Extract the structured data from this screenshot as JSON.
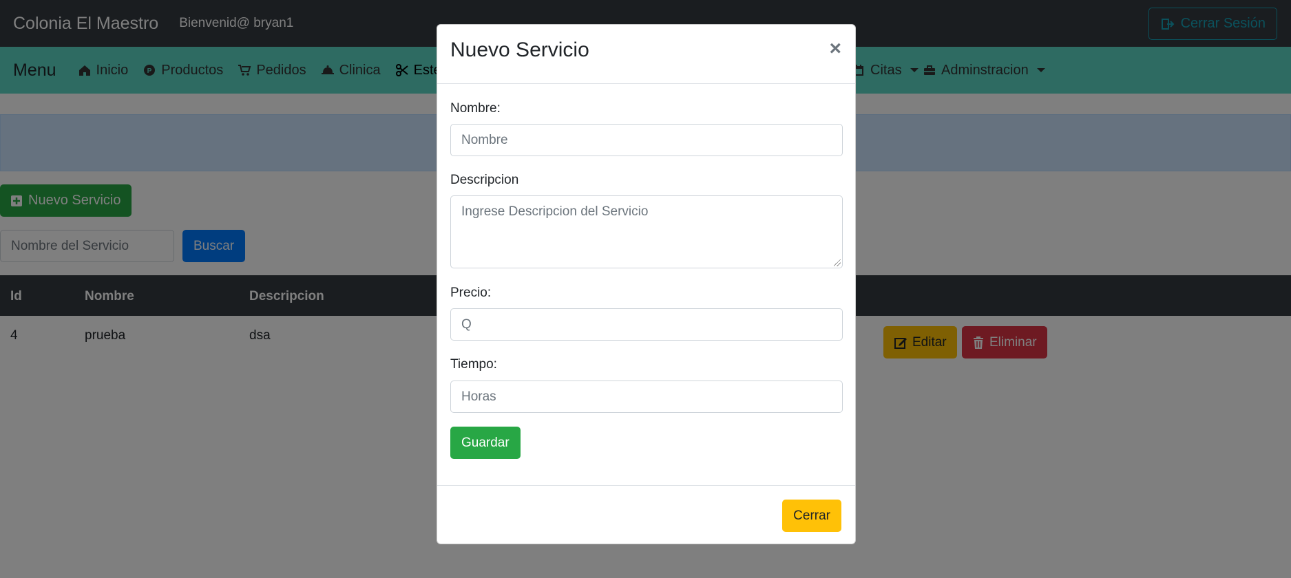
{
  "navbar": {
    "brand": "Colonia El Maestro",
    "welcome": "Bienvenid@ bryan1",
    "logout_label": "Cerrar Sesión",
    "logout_icon": "sign-out-icon"
  },
  "menu": {
    "title": "Menu",
    "items": [
      {
        "label": "Inicio",
        "icon": "home-icon"
      },
      {
        "label": "Productos",
        "icon": "product-icon"
      },
      {
        "label": "Pedidos",
        "icon": "cart-icon"
      },
      {
        "label": "Clinica",
        "icon": "bell-icon"
      },
      {
        "label": "Estetica",
        "icon": "scissors-icon"
      },
      {
        "label": "Citas",
        "icon": "calendar-icon"
      },
      {
        "label": "Adminstracion",
        "icon": "toolbox-icon"
      }
    ]
  },
  "page": {
    "new_button_label": "Nuevo Servicio",
    "search_placeholder": "Nombre del Servicio",
    "search_button_label": "Buscar"
  },
  "table": {
    "headers": [
      "Id",
      "Nombre",
      "Descripcion"
    ],
    "rows": [
      {
        "id": "4",
        "nombre": "prueba",
        "descripcion": "dsa",
        "edit_label": "Editar",
        "delete_label": "Eliminar"
      }
    ]
  },
  "modal": {
    "title": "Nuevo Servicio",
    "close_symbol": "×",
    "nombre_label": "Nombre:",
    "nombre_placeholder": "Nombre",
    "descripcion_label": "Descripcion",
    "descripcion_placeholder": "Ingrese Descripcion del Servicio",
    "precio_label": "Precio:",
    "precio_placeholder": "Q",
    "tiempo_label": "Tiempo:",
    "tiempo_placeholder": "Horas",
    "save_label": "Guardar",
    "close_label": "Cerrar"
  },
  "colors": {
    "navbar": "#343a40",
    "menubar": "#5cd6c5",
    "success": "#28a745",
    "primary": "#007bff",
    "warning": "#ffc107",
    "danger": "#dc3545",
    "info": "#17a2b8"
  }
}
